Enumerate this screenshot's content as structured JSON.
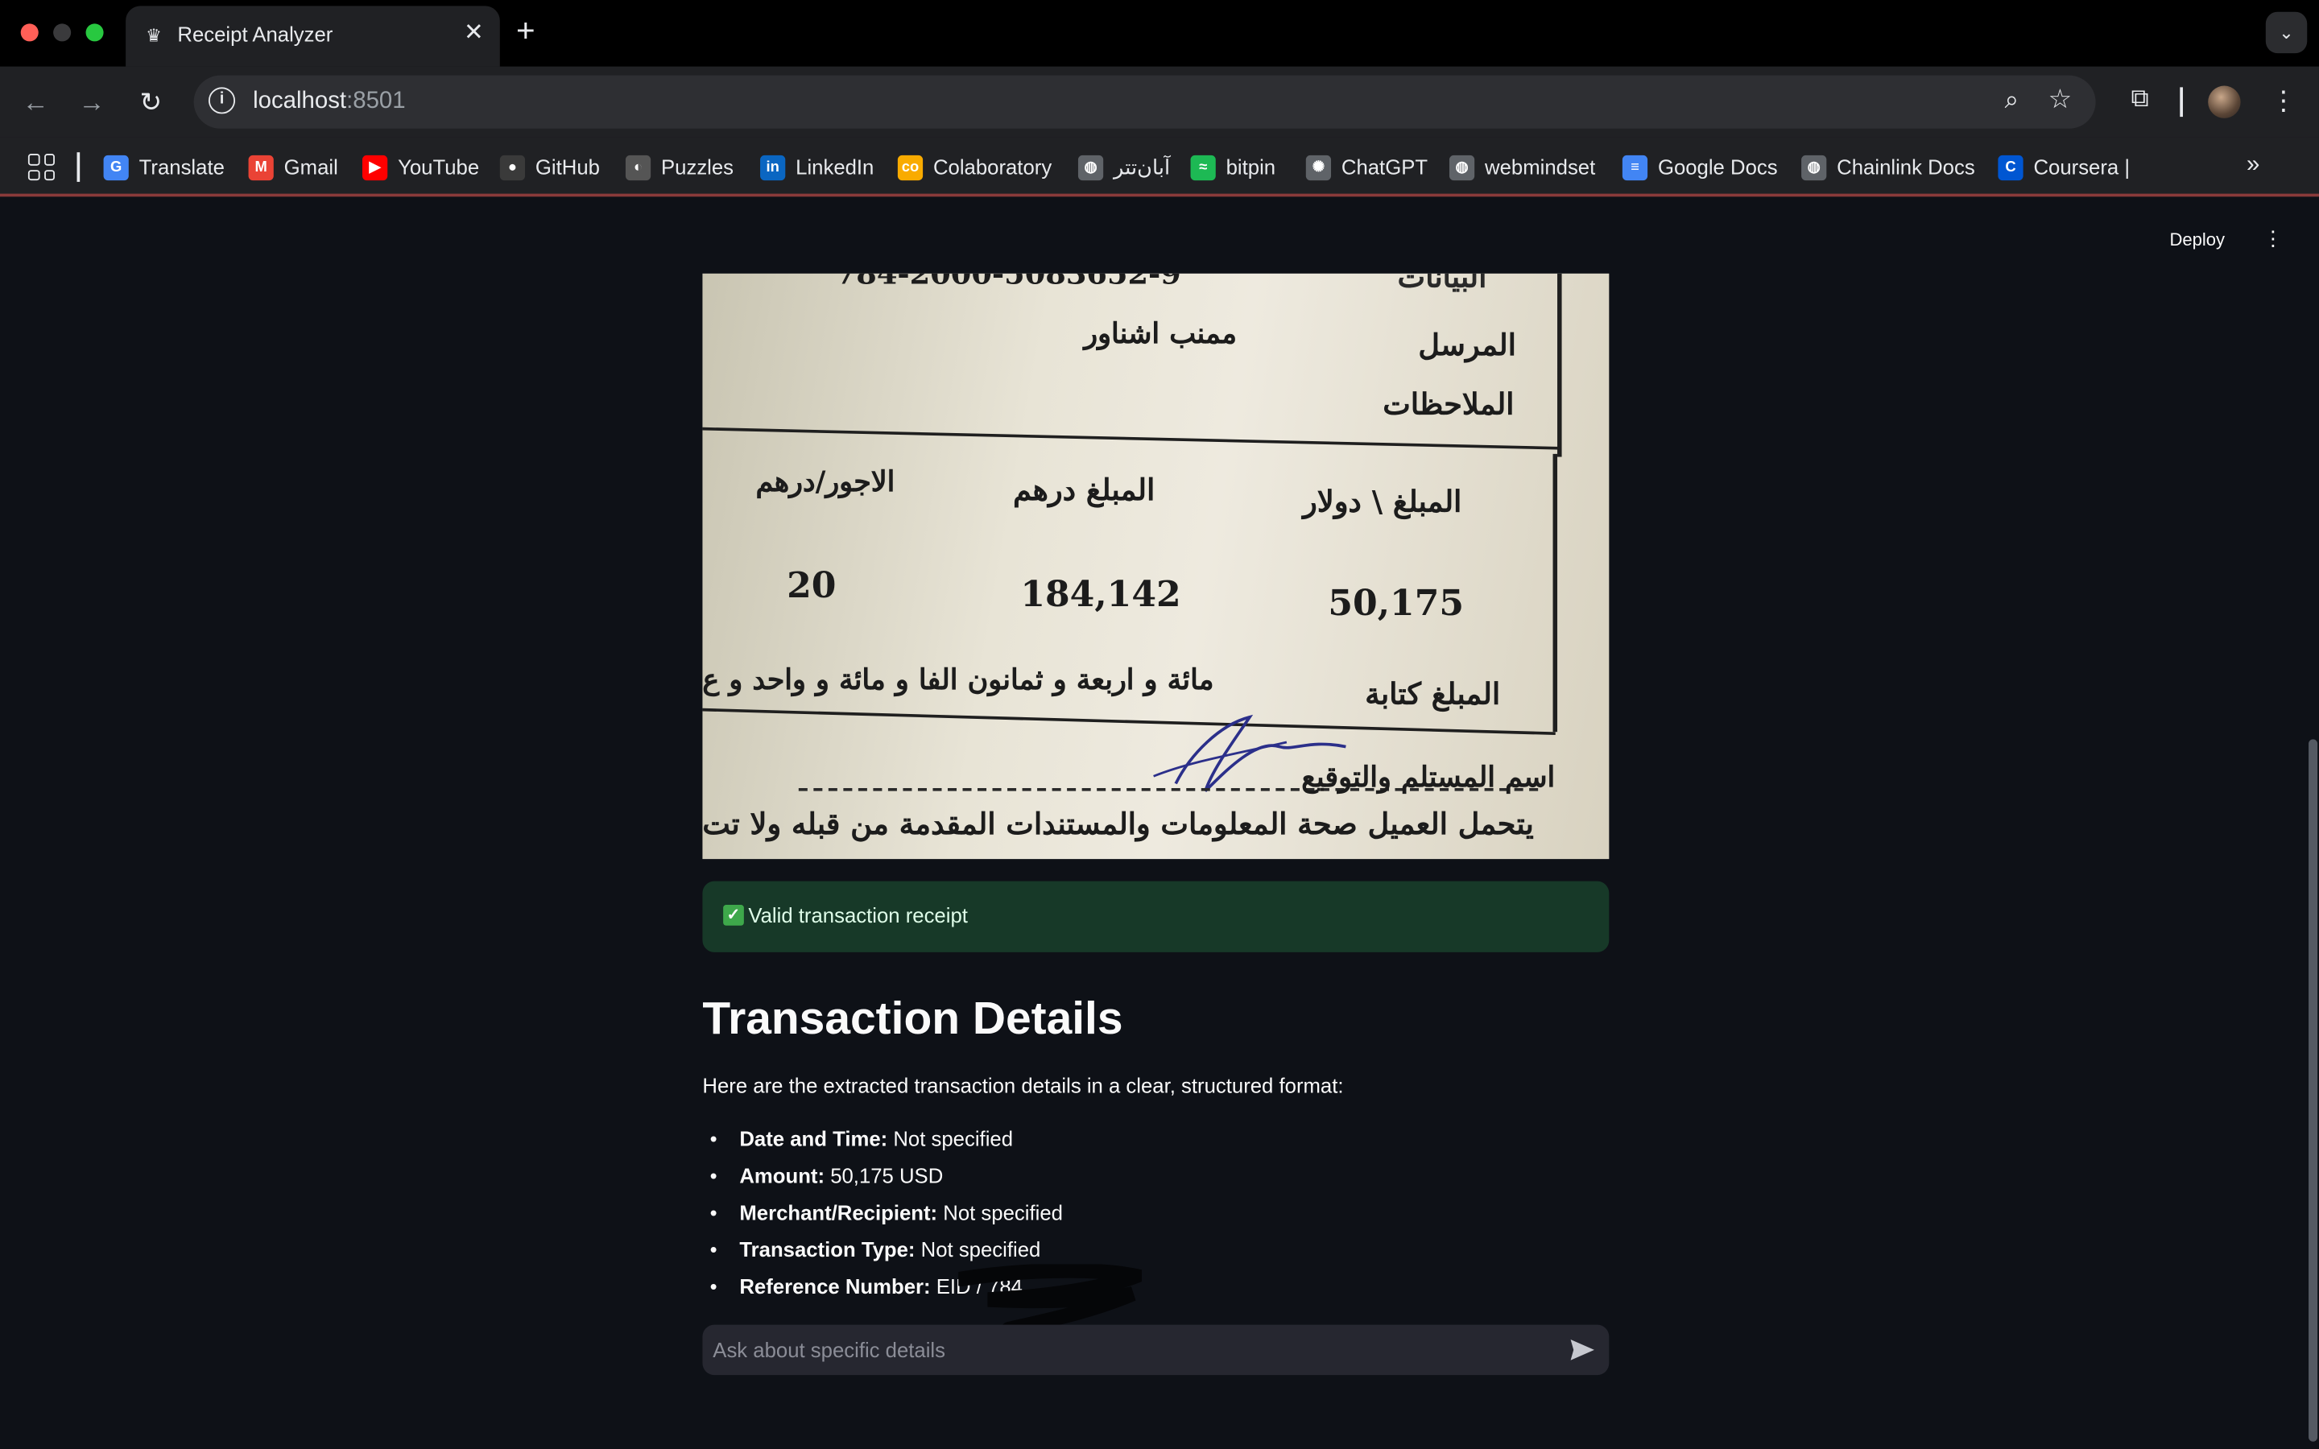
{
  "browser": {
    "tab_title": "Receipt Analyzer",
    "tab_close": "✕",
    "new_tab": "+",
    "tab_menu": "⌄",
    "url_host": "localhost",
    "url_port": ":8501",
    "nav_back": "←",
    "nav_forward": "→",
    "nav_reload": "↻",
    "info": "i",
    "zoom_icon": "⌕",
    "star_icon": "☆",
    "extensions_icon": "⧉",
    "menu_icon": "⋮",
    "bookmarks": [
      {
        "label": "Translate",
        "icon": "translate-icon",
        "color": "#4285f4",
        "glyph": "G"
      },
      {
        "label": "Gmail",
        "icon": "gmail-icon",
        "color": "#ea4335",
        "glyph": "M"
      },
      {
        "label": "YouTube",
        "icon": "youtube-icon",
        "color": "#ff0000",
        "glyph": "▶"
      },
      {
        "label": "GitHub",
        "icon": "github-icon",
        "color": "#3a3a3a",
        "glyph": "●"
      },
      {
        "label": "Puzzles",
        "icon": "puzzles-icon",
        "color": "#555555",
        "glyph": "◐"
      },
      {
        "label": "LinkedIn",
        "icon": "linkedin-icon",
        "color": "#0a66c2",
        "glyph": "in"
      },
      {
        "label": "Colaboratory",
        "icon": "colab-icon",
        "color": "#f9ab00",
        "glyph": "co"
      },
      {
        "label": "آبان‌تتر",
        "icon": "globe-icon",
        "color": "#5f6368",
        "glyph": "◍"
      },
      {
        "label": "bitpin",
        "icon": "bitpin-icon",
        "color": "#1db954",
        "glyph": "≈"
      },
      {
        "label": "ChatGPT",
        "icon": "chatgpt-icon",
        "color": "#5f6368",
        "glyph": "✺"
      },
      {
        "label": "webmindset",
        "icon": "globe-icon",
        "color": "#5f6368",
        "glyph": "◍"
      },
      {
        "label": "Google Docs",
        "icon": "google-docs-icon",
        "color": "#4285f4",
        "glyph": "≡"
      },
      {
        "label": "Chainlink Docs",
        "icon": "globe-icon",
        "color": "#5f6368",
        "glyph": "◍"
      },
      {
        "label": "Coursera |",
        "icon": "coursera-icon",
        "color": "#0056d2",
        "glyph": "C"
      }
    ],
    "bookmarks_more": "»"
  },
  "app": {
    "deploy_label": "Deploy",
    "menu_icon": "⋮",
    "receipt": {
      "header_partial": "البيانات",
      "top_partial": "784-2000-5083652-9",
      "sender_label": "المرسل",
      "sender_value": "ممنب اشناور",
      "notes_label": "الملاحظات",
      "col_usd": "المبلغ \\ دولار",
      "col_aed": "المبلغ درهم",
      "col_fee": "الاجور/درهم",
      "val_usd": "50,175",
      "val_aed": "184,142",
      "val_fee": "20",
      "amount_words_label": "المبلغ كتابة",
      "amount_words_value": "مائة و اربعة و ثمانون الفا و مائة و واحد و ع",
      "receiver_label": "اسم المستلم والتوقيع",
      "footer_text": "يتحمل العميل صحة المعلومات والمستندات المقدمة من قبله ولا تت"
    },
    "alert": {
      "icon": "✓",
      "text": "Valid transaction receipt",
      "color": "#173928"
    },
    "title": "Transaction Details",
    "intro": "Here are the extracted transaction details in a clear, structured format:",
    "details": [
      {
        "label": "Date and Time:",
        "value": "Not specified"
      },
      {
        "label": "Amount:",
        "value": "50,175 USD"
      },
      {
        "label": "Merchant/Recipient:",
        "value": "Not specified"
      },
      {
        "label": "Transaction Type:",
        "value": "Not specified"
      },
      {
        "label": "Reference Number:",
        "value": "EID / 784"
      }
    ],
    "chat": {
      "placeholder": "Ask about specific details"
    }
  }
}
